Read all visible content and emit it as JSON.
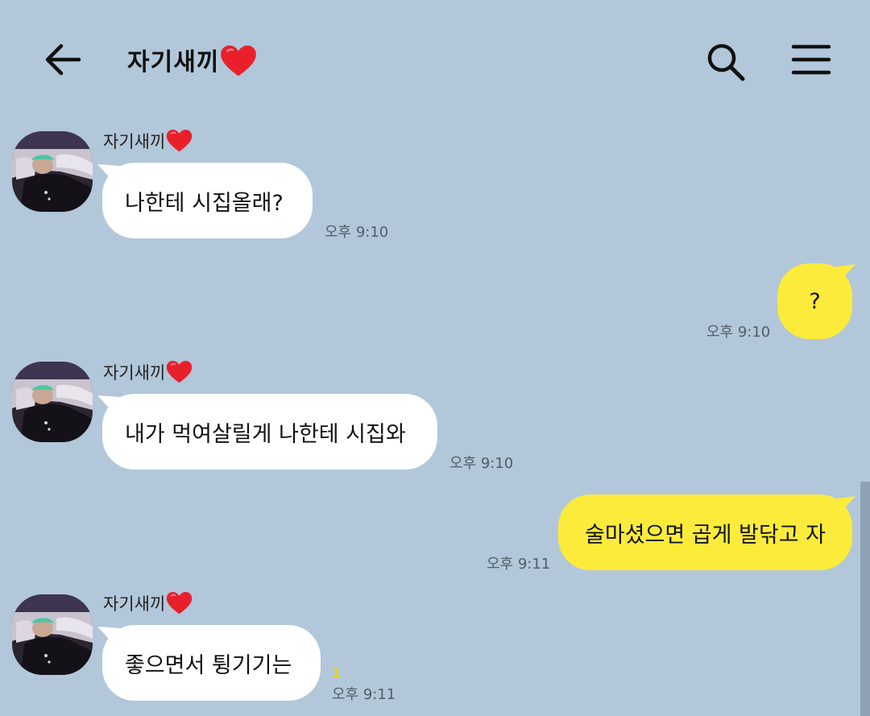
{
  "header": {
    "title": "자기새끼",
    "back_icon": "arrow-left-icon",
    "search_icon": "search-icon",
    "menu_icon": "hamburger-menu-icon"
  },
  "colors": {
    "background": "#b2c7da",
    "incoming_bubble": "#ffffff",
    "outgoing_bubble": "#fdeb3b",
    "heart": "#e8202c",
    "unread": "#f0d400"
  },
  "messages": [
    {
      "sender": "자기새끼",
      "text": "나한테 시집올래?",
      "time": "오후 9:10"
    },
    {
      "text": "?",
      "time": "오후 9:10"
    },
    {
      "sender": "자기새끼",
      "text": "내가 먹여살릴게 나한테 시집와",
      "time": "오후 9:10"
    },
    {
      "text": "술마셨으면 곱게 발닦고 자",
      "time": "오후 9:11"
    },
    {
      "sender": "자기새끼",
      "text": "좋으면서 튕기기는",
      "time": "오후 9:11",
      "unread": "1"
    }
  ]
}
